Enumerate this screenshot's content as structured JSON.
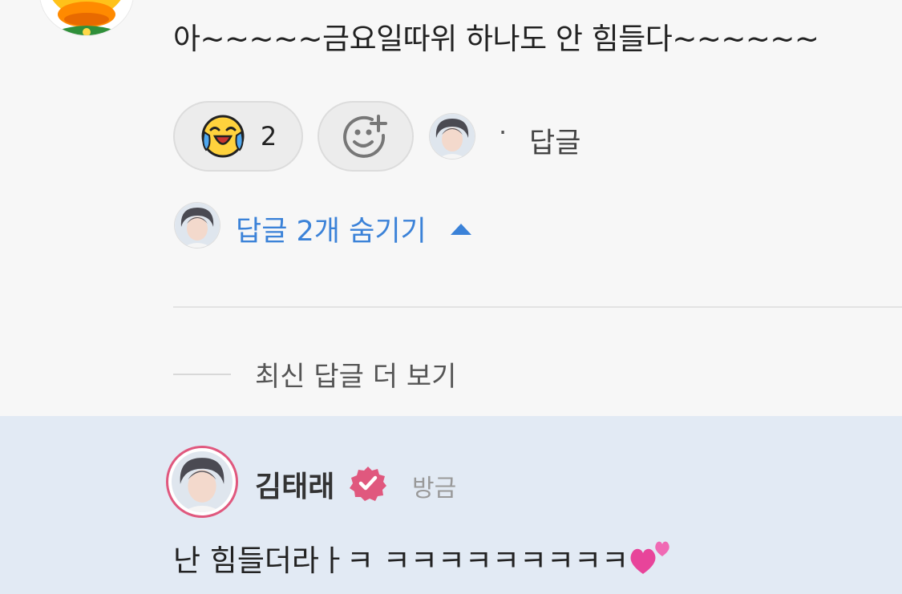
{
  "comment": {
    "text": "아~~~~~금요일따위 하나도 안 힘들다~~~~~~"
  },
  "reactions": {
    "laugh_cry_count": "2",
    "dot": "·",
    "reply_label": "답글"
  },
  "replies": {
    "hide_label": "답글 2개 숨기기",
    "more_label": "최신 답글 더 보기"
  },
  "reply": {
    "author": "김태래",
    "time": "방금",
    "text": "난 힘들더라ㅏㅋ ㅋㅋㅋㅋㅋㅋㅋㅋㅋ"
  },
  "icons": {
    "laugh_cry": "laughing-crying-emoji",
    "add_reaction": "add-reaction-icon",
    "verified": "verified-badge",
    "chevron": "chevron-up",
    "hearts": "two-hearts-emoji"
  },
  "colors": {
    "link_blue": "#3b82d8",
    "verified_pink": "#e0587e",
    "highlight_bg": "#e2eaf4"
  }
}
